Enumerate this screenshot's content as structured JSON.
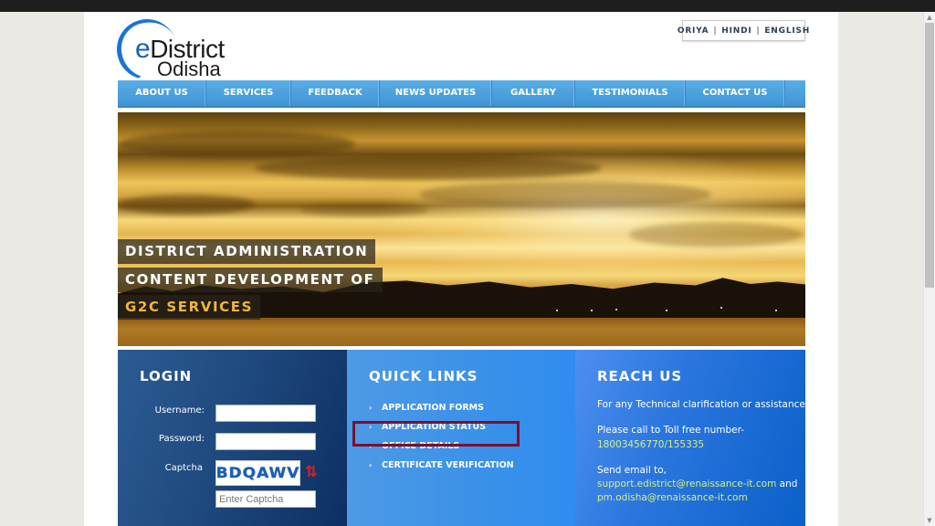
{
  "logo": {
    "line1_e": "e",
    "line1_rest": "District",
    "line2": "Odisha"
  },
  "language": {
    "items": [
      "ORIYA",
      "HINDI",
      "ENGLISH"
    ],
    "separator": "|"
  },
  "nav": {
    "items": [
      {
        "label": "ABOUT US"
      },
      {
        "label": "SERVICES"
      },
      {
        "label": "FEEDBACK"
      },
      {
        "label": "NEWS UPDATES"
      },
      {
        "label": "GALLERY"
      },
      {
        "label": "TESTIMONIALS"
      },
      {
        "label": "CONTACT US"
      }
    ]
  },
  "hero": {
    "captions": [
      "DISTRICT ADMINISTRATION",
      "CONTENT DEVELOPMENT OF",
      "G2C SERVICES"
    ],
    "highlight_color": "#f2b53a"
  },
  "login": {
    "title": "LOGIN",
    "username_label": "Username:",
    "username_value": "",
    "password_label": "Password:",
    "password_value": "",
    "captcha_label": "Captcha",
    "captcha_text": "BDQAWV",
    "captcha_placeholder": "Enter Captcha",
    "refresh_icon": "refresh-icon"
  },
  "quick_links": {
    "title": "QUICK LINKS",
    "chevron": "›",
    "items": [
      "APPLICATION FORMS",
      "APPLICATION STATUS",
      "OFFICE DETAILS",
      "CERTIFICATE VERIFICATION"
    ],
    "highlighted_index": 1,
    "highlight_color": "#7a1030"
  },
  "reach_us": {
    "title": "REACH US",
    "line1": "For any Technical clarification or assistance,",
    "line2": "Please call to Toll free number-",
    "phone": "18003456770/155335",
    "line3": "Send email to,",
    "email1": "support.edistrict@renaissance-it.com",
    "and": " and",
    "email2": "pm.odisha@renaissance-it.com",
    "link_color": "#d8f080"
  },
  "scrollbar": {
    "up_icon": "▲",
    "down_icon": "▼"
  }
}
